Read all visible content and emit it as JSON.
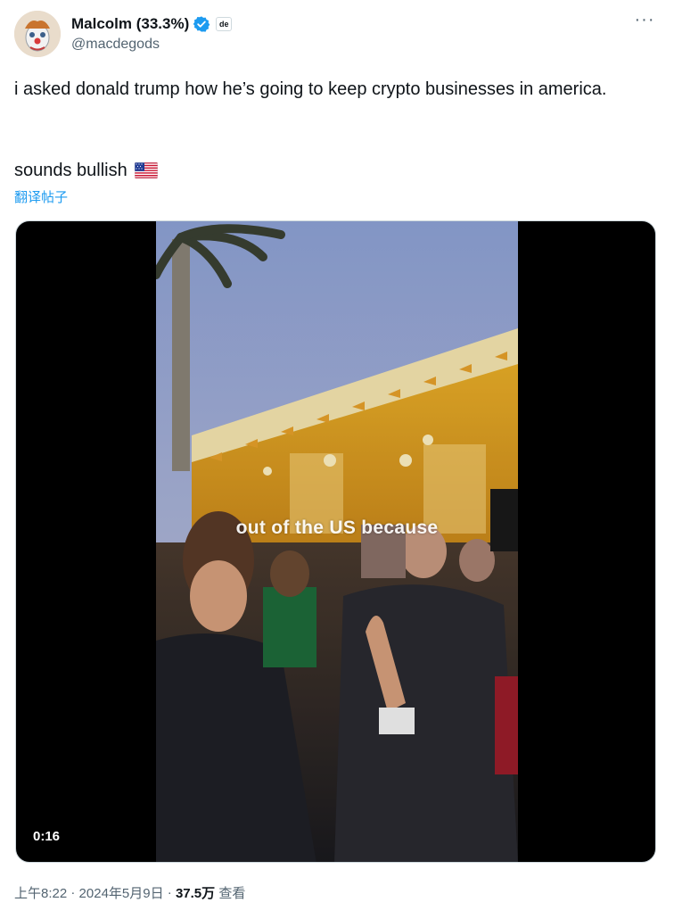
{
  "author": {
    "display_name": "Malcolm (33.3%)",
    "handle": "@macdegods",
    "affiliate_badge": "de",
    "more_label": "···",
    "verified_icon": "blue-check-icon"
  },
  "tweet": {
    "text": "i asked donald trump how he’s going to keep crypto businesses in america.",
    "text2": "sounds bullish",
    "flag_icon": "us-flag-icon",
    "translate_label": "翻译帖子"
  },
  "video": {
    "caption": "out of the US because",
    "duration": "0:16"
  },
  "meta": {
    "time": "上午8:22",
    "sep1": " · ",
    "date": "2024年5月9日",
    "sep2": " · ",
    "views": "37.5万",
    "views_label": " 查看"
  },
  "colors": {
    "link": "#1d9bf0",
    "secondary_text": "#536471",
    "primary_text": "#0f1419",
    "verified": "#1d9bf0"
  }
}
